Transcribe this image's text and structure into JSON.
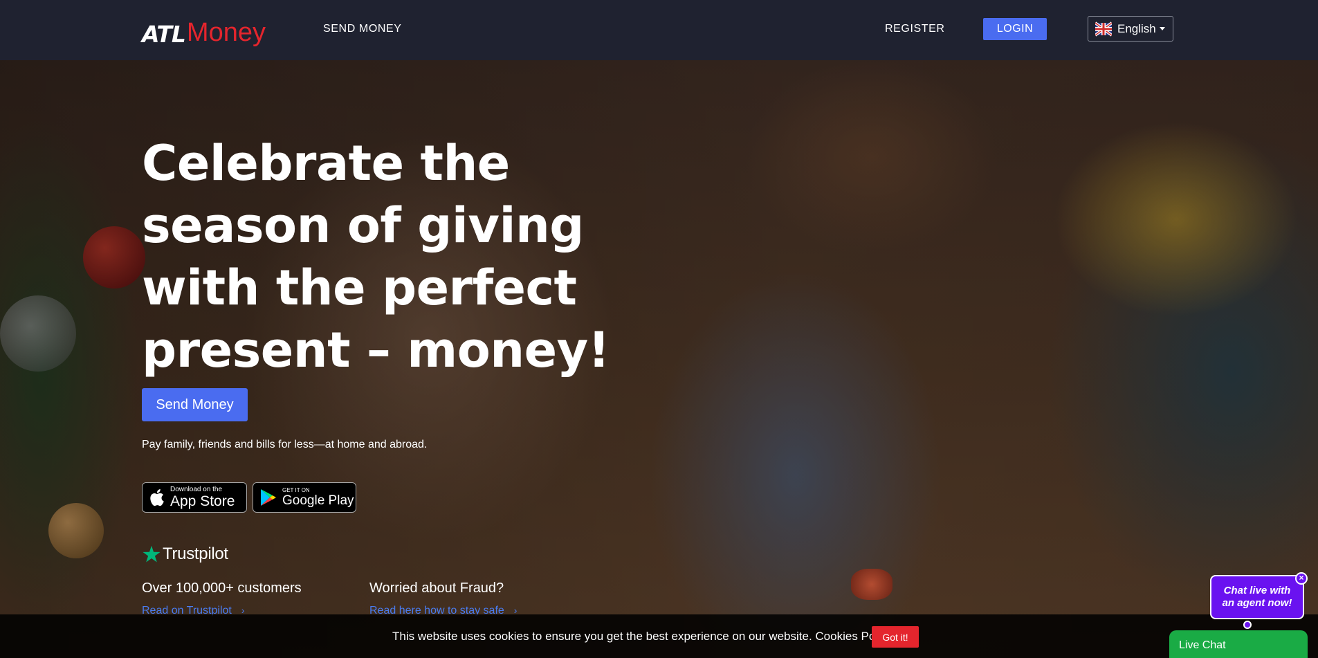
{
  "brand": {
    "logo_part1": "ATL",
    "logo_part2": "Money"
  },
  "nav": {
    "send_money": "SEND MONEY",
    "register": "REGISTER",
    "login": "LOGIN",
    "language": "English",
    "language_icon": "uk-flag-icon"
  },
  "hero": {
    "headline": "Celebrate the season of giving with the perfect present – money!",
    "cta": "Send Money",
    "tagline": "Pay family, friends and bills for less—at home and abroad.",
    "app_store": {
      "small": "Download on the",
      "big": "App Store"
    },
    "google_play": {
      "small": "GET IT ON",
      "big": "Google Play"
    },
    "trustpilot": "Trustpilot",
    "customers": {
      "title": "Over 100,000+ customers",
      "link": "Read on Trustpilot"
    },
    "fraud": {
      "title": "Worried about Fraud?",
      "link": "Read here how to stay safe"
    }
  },
  "cookie": {
    "text": "This website uses cookies to ensure you get the best experience on our website. Cookies Policy.",
    "button": "Got it!"
  },
  "chat": {
    "bubble": "Chat live with an agent now!",
    "close": "×",
    "button": "Live Chat"
  },
  "colors": {
    "nav_bg": "#1f2230",
    "brand_red": "#e4252d",
    "accent_blue": "#4a6cf0",
    "link_blue": "#4a7cf0",
    "trustpilot_green": "#00b67a",
    "chat_purple": "#6a12f0",
    "chat_green": "#1aab45"
  }
}
